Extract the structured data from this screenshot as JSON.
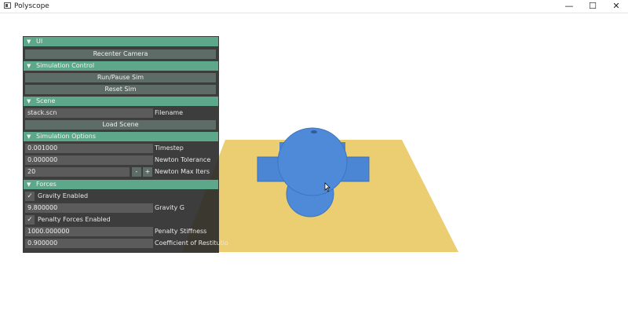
{
  "window": {
    "title": "Polyscope",
    "minimize": "—",
    "maximize": "☐",
    "close": "✕"
  },
  "colors": {
    "accent": "#5da88a",
    "ground": "#ebcd72",
    "mesh": "#4a86d4"
  },
  "panel": {
    "ui_header": "UI",
    "recenter_camera": "Recenter Camera",
    "simulation_control": {
      "header": "Simulation Control",
      "run_pause": "Run/Pause Sim",
      "reset": "Reset Sim"
    },
    "scene": {
      "header": "Scene",
      "filename_value": "stack.scn",
      "filename_label": "Filename",
      "load_scene": "Load Scene"
    },
    "simulation_options": {
      "header": "Simulation Options",
      "timestep_value": "0.001000",
      "timestep_label": "Timestep",
      "newton_tolerance_value": "0.000000",
      "newton_tolerance_label": "Newton Tolerance",
      "newton_max_iters_value": "20",
      "newton_max_iters_label": "Newton Max Iters",
      "minus": "-",
      "plus": "+"
    },
    "forces": {
      "header": "Forces",
      "gravity_enabled_label": "Gravity Enabled",
      "gravity_g_value": "9.800000",
      "gravity_g_label": "Gravity G",
      "penalty_forces_label": "Penalty Forces Enabled",
      "penalty_stiffness_value": "1000.000000",
      "penalty_stiffness_label": "Penalty Stiffness",
      "restitution_value": "0.900000",
      "restitution_label": "Coefficient of Restitutio"
    }
  }
}
